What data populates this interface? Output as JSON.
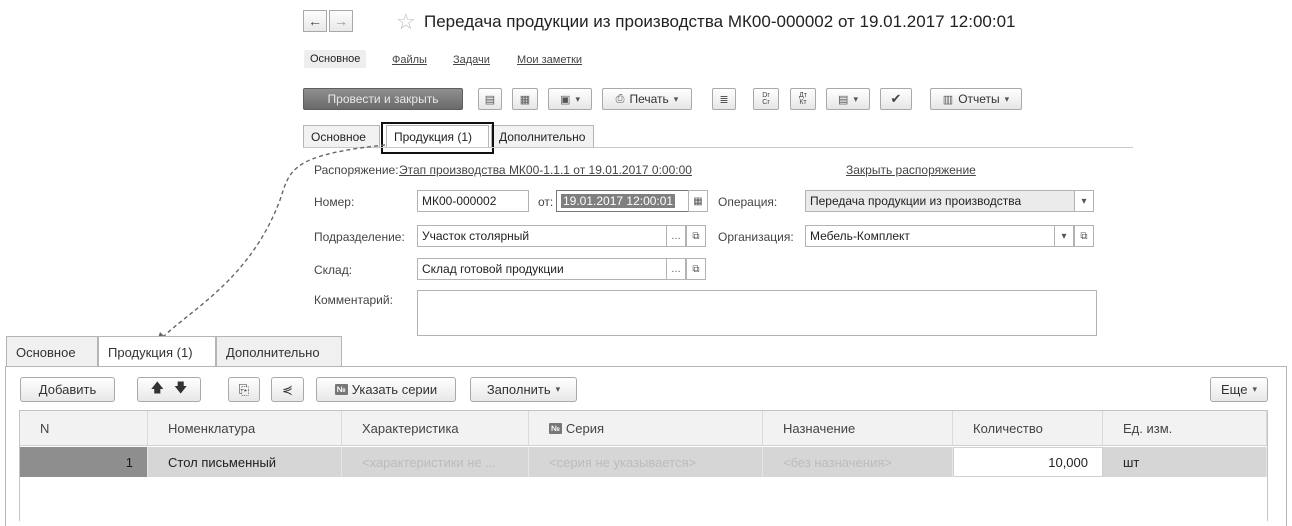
{
  "header": {
    "back_glyph": "←",
    "forward_glyph": "→",
    "title": "Передача продукции из производства МК00-000002 от 19.01.2017 12:00:01"
  },
  "form_links": [
    "Основное",
    "Файлы",
    "Задачи",
    "Мои заметки"
  ],
  "toolbar": {
    "post_close": "Провести и закрыть",
    "print": "Печать",
    "dt_label": "Dr\nCr",
    "reports": "Отчеты"
  },
  "form_tabs": [
    "Основное",
    "Продукция (1)",
    "Дополнительно"
  ],
  "fields": {
    "order_label": "Распоряжение:",
    "order_link": "Этап производства МК00-1.1.1 от 19.01.2017 0:00:00",
    "close_order_link": "Закрыть распоряжение",
    "number_label": "Номер:",
    "number_value": "МК00-000002",
    "date_label": "от:",
    "date_value": "19.01.2017 12:00:01",
    "operation_label": "Операция:",
    "operation_value": "Передача продукции из производства",
    "division_label": "Подразделение:",
    "division_value": "Участок столярный",
    "organization_label": "Организация:",
    "organization_value": "Мебель-Комплект",
    "warehouse_label": "Склад:",
    "warehouse_value": "Склад готовой продукции",
    "comment_label": "Комментарий:",
    "comment_value": ""
  },
  "bottom_tabs": [
    "Основное",
    "Продукция (1)",
    "Дополнительно"
  ],
  "table_toolbar": {
    "add": "Добавить",
    "specify_series": "Указать серии",
    "fill": "Заполнить",
    "more": "Еще",
    "series_badge": "№"
  },
  "table": {
    "columns": [
      "N",
      "Номенклатура",
      "Характеристика",
      "Серия",
      "Назначение",
      "Количество",
      "Ед. изм."
    ],
    "rows": [
      {
        "n": "1",
        "item": "Стол письменный",
        "characteristic": "<характеристики не ...",
        "series": "<серия не указывается>",
        "purpose": "<без назначения>",
        "quantity": "10,000",
        "unit": "шт"
      }
    ]
  },
  "colors": {
    "primary_button": "#7a7a7a",
    "selected_row": "#d6d6d6",
    "row_number_cell": "#8e8e8e",
    "header_bg": "#f2f2f2"
  }
}
